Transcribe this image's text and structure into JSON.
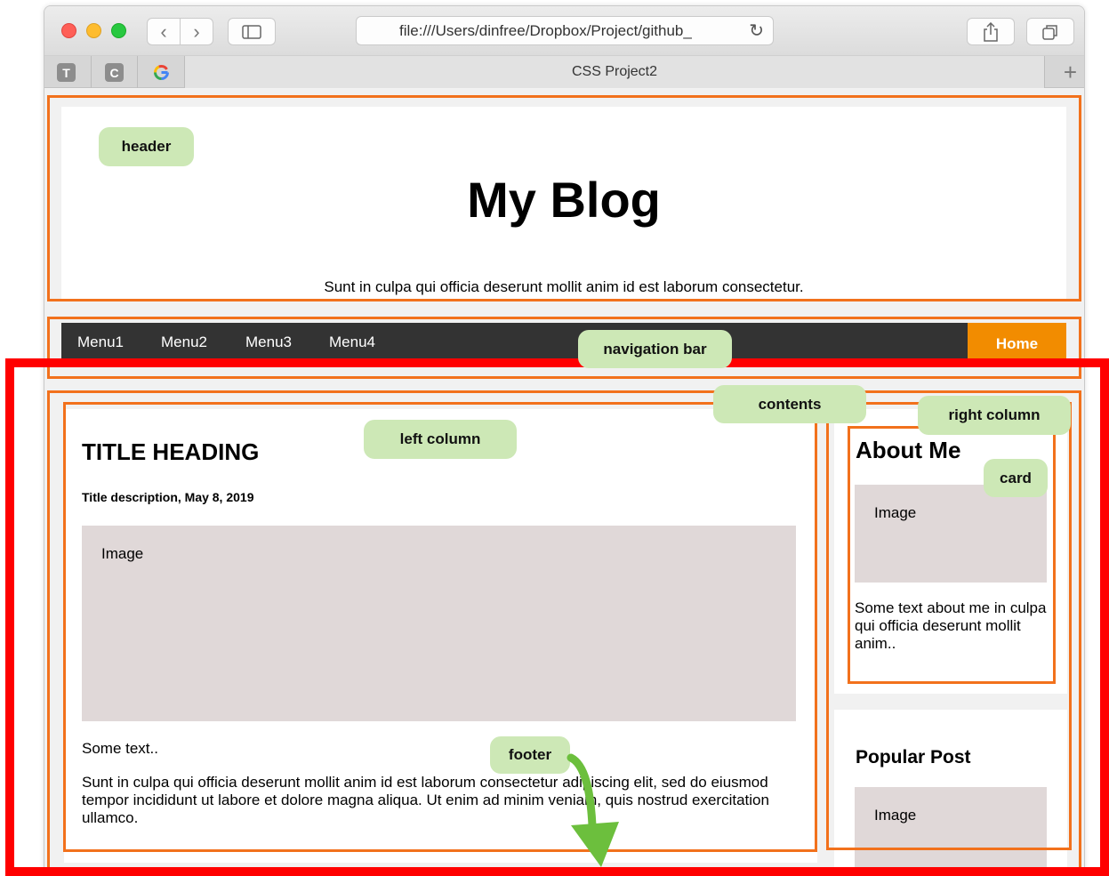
{
  "browser": {
    "address": "file:///Users/dinfree/Dropbox/Project/github_",
    "tab_title": "CSS Project2",
    "favicons": [
      "T",
      "C",
      "G"
    ]
  },
  "header": {
    "title": "My Blog",
    "tagline": "Sunt in culpa qui officia deserunt mollit anim id est laborum consectetur."
  },
  "nav": {
    "items": [
      "Menu1",
      "Menu2",
      "Menu3",
      "Menu4"
    ],
    "home": "Home"
  },
  "left_column": {
    "title": "TITLE HEADING",
    "description": "Title description, May 8, 2019",
    "image_label": "Image",
    "some_text": "Some text..",
    "body": "Sunt in culpa qui officia deserunt mollit anim id est laborum consectetur adipiscing elit, sed do eiusmod tempor incididunt ut labore et dolore magna aliqua. Ut enim ad minim veniam, quis nostrud exercitation ullamco."
  },
  "right_column": {
    "about_title": "About Me",
    "about_image_label": "Image",
    "about_text": "Some text about me in culpa qui officia deserunt mollit anim..",
    "popular_title": "Popular Post",
    "popular_image_label": "Image"
  },
  "annotations": {
    "header": "header",
    "navigation_bar": "navigation bar",
    "contents": "contents",
    "left_column": "left column",
    "right_column": "right column",
    "card": "card",
    "footer": "footer"
  },
  "colors": {
    "outline": "#f2711c",
    "highlight": "#ff0000",
    "tag_bg": "#cde8b6",
    "nav_bg": "#333333",
    "home_bg": "#f28c00",
    "image_bg": "#e0d8d8",
    "arrow": "#6cbf3d"
  }
}
